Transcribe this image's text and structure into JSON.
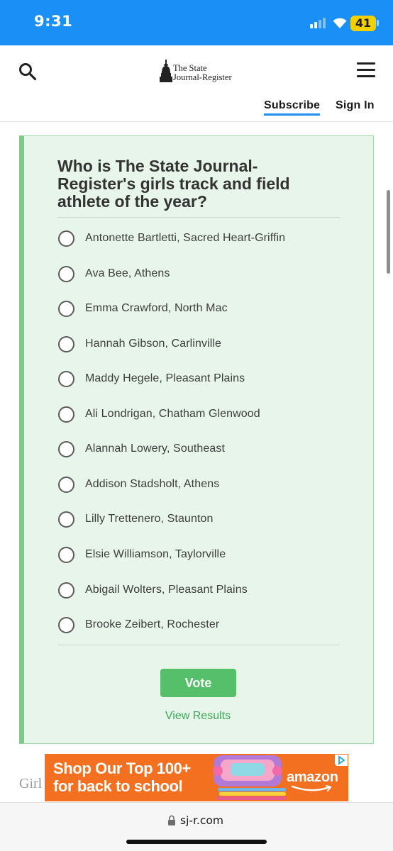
{
  "status_bar": {
    "time": "9:31",
    "battery": "41",
    "background_color": "#1a8ff5",
    "battery_color": "#f3d100",
    "icons": [
      "cellular-signal-icon",
      "wifi-icon",
      "battery-icon"
    ]
  },
  "header": {
    "logo_line1": "The State",
    "logo_line2": "Journal-Register",
    "subscribe_label": "Subscribe",
    "signin_label": "Sign In",
    "icons": [
      "search-icon",
      "capitol-dome-icon",
      "hamburger-menu-icon"
    ],
    "accent_color": "#1a8ff5"
  },
  "poll": {
    "question": "Who is The State Journal-Register's girls track and field athlete of the year?",
    "options": [
      "Antonette Bartletti, Sacred Heart-Griffin",
      "Ava Bee, Athens",
      "Emma Crawford, North Mac",
      "Hannah Gibson, Carlinville",
      "Maddy Hegele, Pleasant Plains",
      "Ali Londrigan, Chatham Glenwood",
      "Alannah Lowery, Southeast",
      "Addison Stadsholt, Athens",
      "Lilly Trettenero, Staunton",
      "Elsie Williamson, Taylorville",
      "Abigail Wolters, Pleasant Plains",
      "Brooke Zeibert, Rochester"
    ],
    "vote_label": "Vote",
    "view_results_label": "View Results",
    "card_background": "#e8f5ea",
    "accent_color": "#55bf6a"
  },
  "article": {
    "peek_text": "Girl"
  },
  "ad": {
    "line1": "Shop Our Top 100+",
    "line2": "for back to school",
    "brand": "amazon",
    "background_color": "#f37021",
    "icons": [
      "adchoices-icon"
    ]
  },
  "browser": {
    "url": "sj-r.com",
    "icons": [
      "lock-icon"
    ]
  }
}
